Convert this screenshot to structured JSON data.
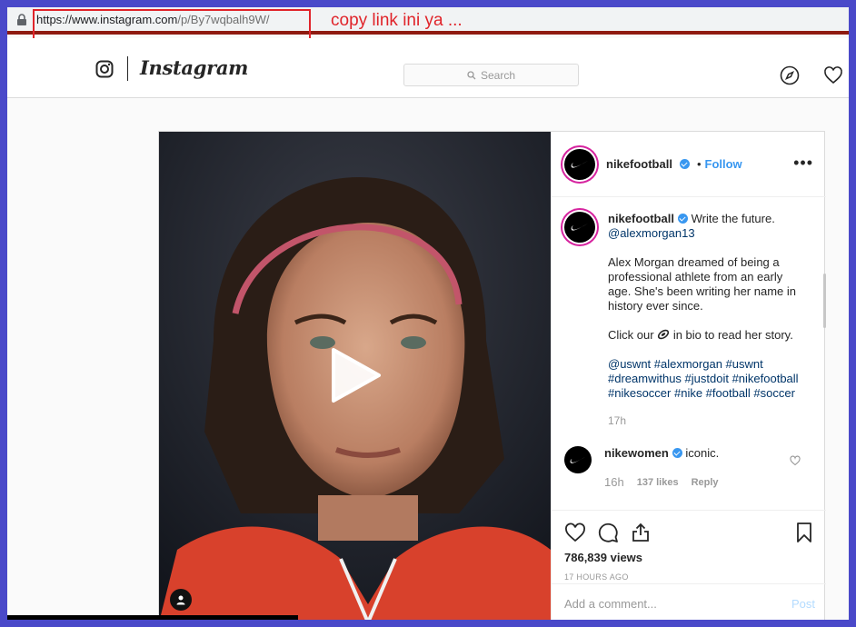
{
  "browser": {
    "url_base": "https://www.instagram.com",
    "url_path": "/p/By7wqbalh9W/",
    "annotation_text": "copy link ini ya ..."
  },
  "header": {
    "wordmark": "Instagram",
    "search_placeholder": "Search",
    "icons": [
      "camera-icon",
      "search-icon",
      "explore-compass-icon",
      "heart-icon"
    ]
  },
  "post": {
    "username": "nikefootball",
    "follow_label": "Follow",
    "bullet": "•",
    "more_label": "•••",
    "caption": {
      "username": "nikefootball",
      "first_line": "Write the future.",
      "mention": "@alexmorgan13",
      "paragraph1": "Alex Morgan dreamed of being a professional athlete from an early age. She's been writing her name in history ever since.",
      "paragraph2_before": "Click our",
      "paragraph2_after": "in bio to read her story.",
      "hashtags": "@uswnt #alexmorgan #uswnt #dreamwithus #justdoit #nikefootball #nikesoccer #nike #football #soccer",
      "time": "17h"
    },
    "comment": {
      "username": "nikewomen",
      "text": "iconic.",
      "time": "16h",
      "likes": "137 likes",
      "reply_label": "Reply"
    },
    "views": "786,839 views",
    "ago": "17 HOURS AGO",
    "add_comment_placeholder": "Add a comment...",
    "post_button": "Post"
  },
  "colors": {
    "accent_blue": "#3897f0",
    "annotation_red": "#e0242a",
    "frame": "#4a49c9"
  }
}
